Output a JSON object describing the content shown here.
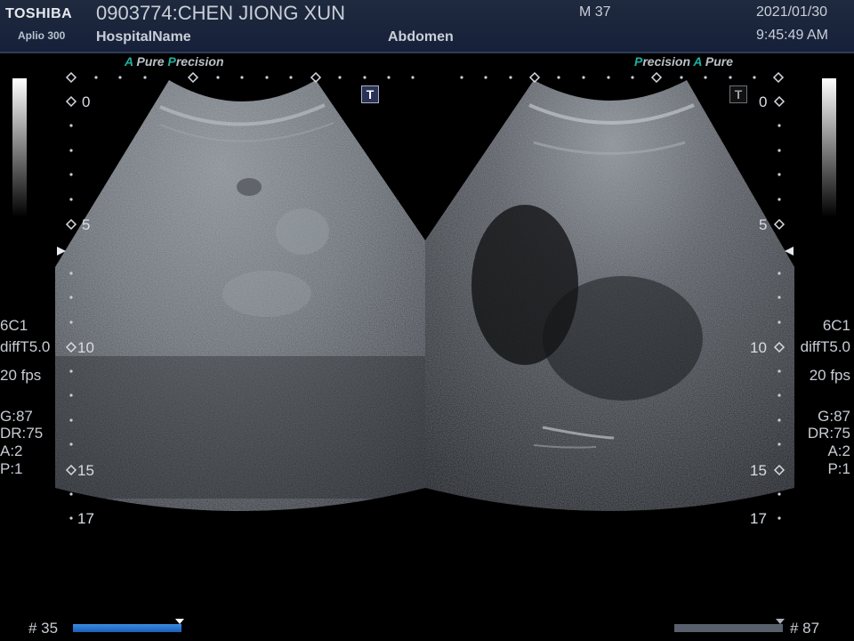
{
  "header": {
    "brand": "TOSHIBA",
    "model": "Aplio 300",
    "patient": "0903774:CHEN JIONG XUN",
    "hospital": "HospitalName",
    "exam": "Abdomen",
    "mode": "M 37",
    "date": "2021/01/30",
    "time": "9:45:49 AM"
  },
  "logo": {
    "left": {
      "a1": "A",
      "w1": " Pure ",
      "a2": "P",
      "w2": "recision"
    },
    "right": {
      "a1": "P",
      "w1": "recision ",
      "a2": "A",
      "w2": " Pure"
    }
  },
  "t_button": "T",
  "depth_labels": {
    "d0": "0",
    "d5": "5",
    "d10": "10",
    "d15": "15",
    "d17": "17"
  },
  "params": {
    "probe": "6C1",
    "filter": "diffT5.0",
    "fps": "20 fps",
    "gain": "G:87",
    "dynamic_range": "DR:75",
    "a": "A:2",
    "p": "P:1"
  },
  "footer": {
    "left_frame": "# 35",
    "right_frame": "# 87"
  },
  "colors": {
    "accent": "#1fb0a0",
    "header_bg": "#1f2a3e",
    "frame_bar": "#2f7ad6"
  }
}
